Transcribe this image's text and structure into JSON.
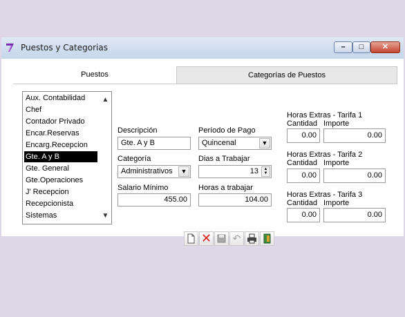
{
  "window": {
    "title": "Puestos y Categorias"
  },
  "tabs": [
    {
      "label": "Puestos"
    },
    {
      "label": "Categorías de Puestos"
    }
  ],
  "list": {
    "items": [
      "Aux. Contabilidad",
      "Chef",
      "Contador Privado",
      "Encar.Reservas",
      "Encarg.Recepcion",
      "Gte. A y B",
      "Gte. General",
      "Gte.Operaciones",
      "J' Recepcion",
      "Recepcionista",
      "Sistemas"
    ],
    "selected": "Gte. A y B"
  },
  "form": {
    "descripcion_label": "Descripción",
    "descripcion_value": "Gte. A y B",
    "categoria_label": "Categoría",
    "categoria_value": "Administrativos",
    "salario_label": "Salario Mínimo",
    "salario_value": "455.00",
    "periodo_label": "Período de Pago",
    "periodo_value": "Quincenal",
    "dias_label": "Dias a Trabajar",
    "dias_value": "13",
    "horas_label": "Horas a trabajar",
    "horas_value": "104.00"
  },
  "overtime": [
    {
      "title": "Horas Extras - Tarifa 1",
      "cantidad_label": "Cantidad",
      "importe_label": "Importe",
      "cantidad": "0.00",
      "importe": "0.00"
    },
    {
      "title": "Horas Extras - Tarifa 2",
      "cantidad_label": "Cantidad",
      "importe_label": "Importe",
      "cantidad": "0.00",
      "importe": "0.00"
    },
    {
      "title": "Horas Extras - Tarifa 3",
      "cantidad_label": "Cantidad",
      "importe_label": "Importe",
      "cantidad": "0.00",
      "importe": "0.00"
    }
  ],
  "toolbar": {
    "icons": [
      "new-icon",
      "delete-icon",
      "save-icon",
      "undo-icon",
      "print-icon",
      "exit-icon"
    ]
  },
  "colors": {
    "selection": "#000000",
    "delete": "#e02020",
    "accent": "#7a2fb0"
  }
}
